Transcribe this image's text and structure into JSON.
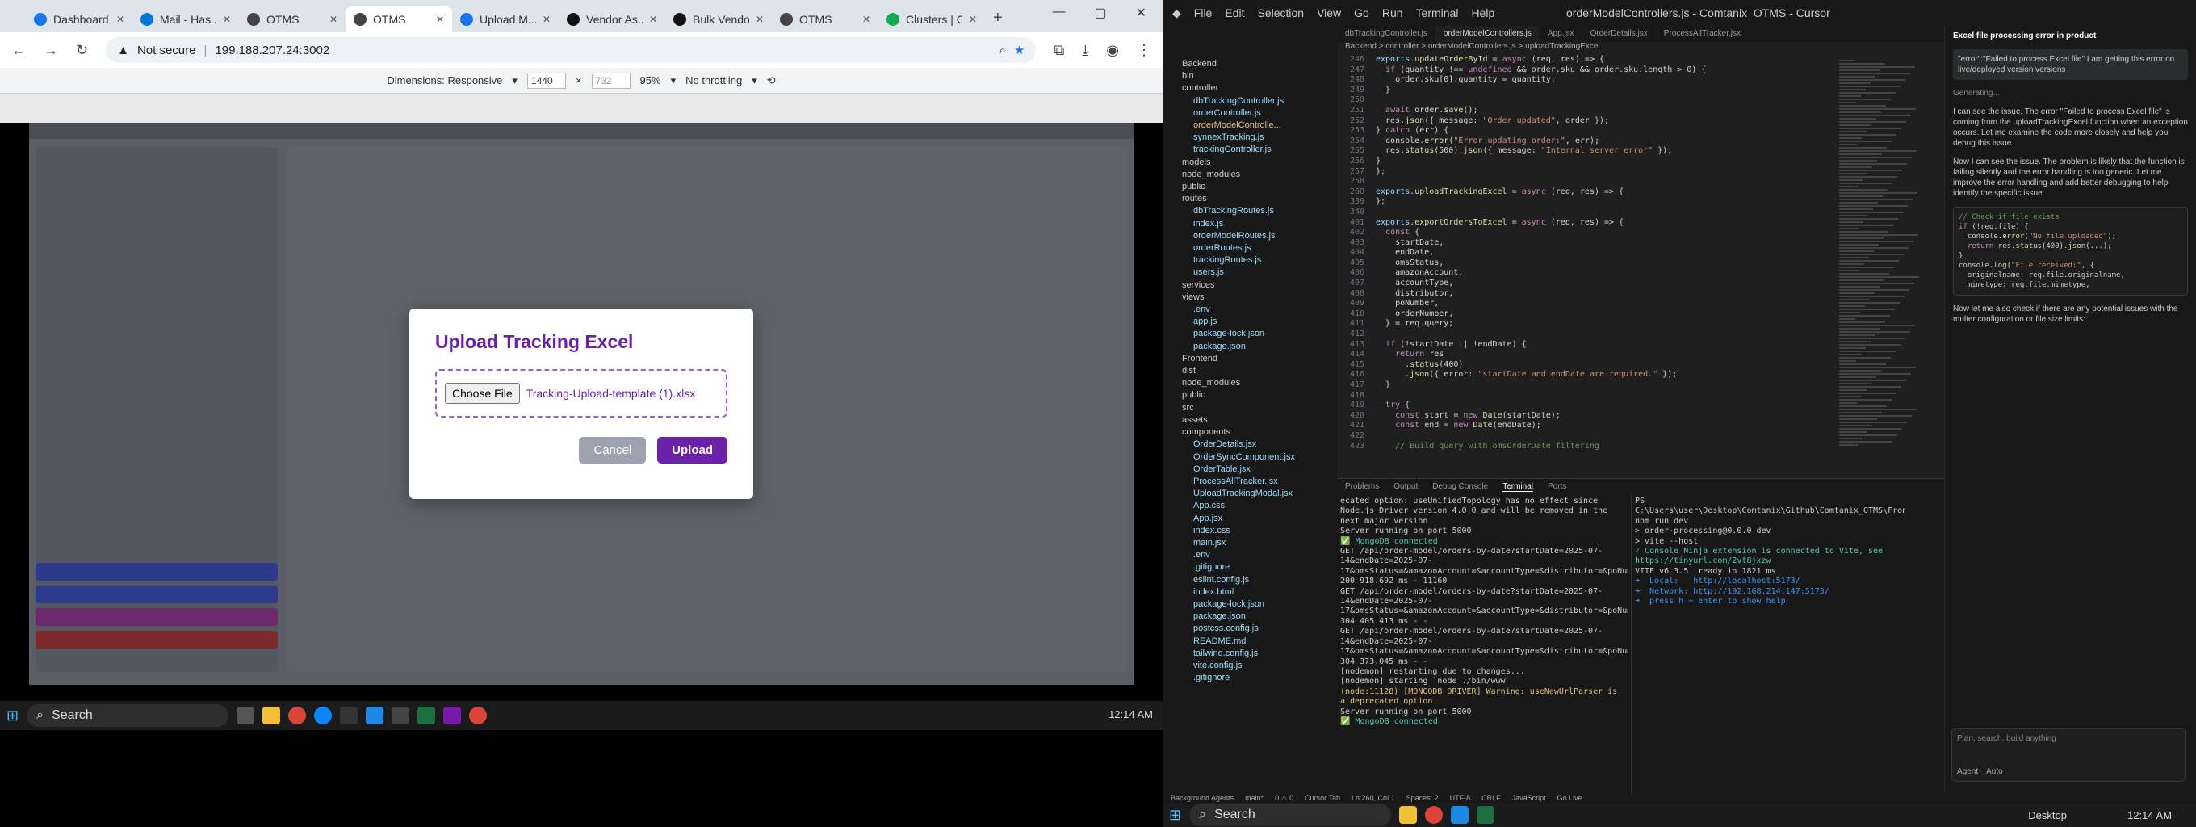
{
  "browser": {
    "tabs": [
      {
        "label": "Dashboard",
        "color": "#1a73e8"
      },
      {
        "label": "Mail - Has...",
        "color": "#0078d4"
      },
      {
        "label": "OTMS",
        "color": "#444"
      },
      {
        "label": "OTMS",
        "color": "#444",
        "active": true
      },
      {
        "label": "Upload M...",
        "color": "#1a73e8"
      },
      {
        "label": "Vendor As...",
        "color": "#111"
      },
      {
        "label": "Bulk Vendo...",
        "color": "#111"
      },
      {
        "label": "OTMS",
        "color": "#444"
      },
      {
        "label": "Clusters | C...",
        "color": "#13aa52"
      }
    ],
    "security": "Not secure",
    "url": "199.188.207.24:3002",
    "devtools": {
      "dimensions_label": "Dimensions: Responsive",
      "width": "1440",
      "height": "732",
      "zoom": "95%",
      "throttle": "No throttling"
    }
  },
  "modal": {
    "title": "Upload Tracking Excel",
    "choose_label": "Choose File",
    "file_name": "Tracking-Upload-template (1).xlsx",
    "cancel_label": "Cancel",
    "upload_label": "Upload"
  },
  "taskbar_left": {
    "search": "Search",
    "time": "12:14 AM"
  },
  "vscode": {
    "title": "orderModelControllers.js - Comtanix_OTMS - Cursor",
    "menu": [
      "File",
      "Edit",
      "Selection",
      "View",
      "Go",
      "Run",
      "Terminal",
      "Help"
    ],
    "tree": [
      "Backend",
      "bin",
      "controller",
      "dbTrackingController.js",
      "orderController.js",
      "orderModelControlle...",
      "synnexTracking.js",
      "trackingController.js",
      "models",
      "node_modules",
      "public",
      "routes",
      "dbTrackingRoutes.js",
      "index.js",
      "orderModelRoutes.js",
      "orderRoutes.js",
      "trackingRoutes.js",
      "users.js",
      "services",
      "views",
      ".env",
      "app.js",
      "package-lock.json",
      "package.json",
      "Frontend",
      "dist",
      "node_modules",
      "public",
      "src",
      "assets",
      "components",
      "OrderDetails.jsx",
      "OrderSyncComponent.jsx",
      "OrderTable.jsx",
      "ProcessAllTracker.jsx",
      "UploadTrackingModal.jsx",
      "App.css",
      "App.jsx",
      "index.css",
      "main.jsx",
      ".env",
      ".gitignore",
      "eslint.config.js",
      "index.html",
      "package-lock.json",
      "package.json",
      "postcss.config.js",
      "README.md",
      "tailwind.config.js",
      "vite.config.js",
      ".gitignore"
    ],
    "editor_tabs": [
      "dbTrackingController.js",
      "orderModelControllers.js",
      "App.jsx",
      "OrderDetails.jsx",
      "ProcessAllTracker.jsx"
    ],
    "breadcrumb": "Backend > controller > orderModelControllers.js > uploadTrackingExcel",
    "panel_tabs": [
      "Problems",
      "Output",
      "Debug Console",
      "Terminal",
      "Ports"
    ],
    "status_items": [
      "Background Agents",
      "main*",
      "0 ⚠ 0",
      "Cursor Tab",
      "Ln 260, Col 1",
      "Spaces: 2",
      "UTF-8",
      "CRLF",
      "JavaScript",
      "Go Live"
    ]
  },
  "terminal_backend": [
    "ecated option: useUnifiedTopology has no effect since Node.js Driver version 4.0.0 and will be removed in the next major version",
    "Server running on port 5000",
    "✅ MongoDB connected",
    "GET /api/order-model/orders-by-date?startDate=2025-07-14&endDate=2025-07-17&omsStatus=&amazonAccount=&accountType=&distributor=&poNumber=&orderNumber=&page=1&limit=20 200 918.692 ms - 11160",
    "GET /api/order-model/orders-by-date?startDate=2025-07-14&endDate=2025-07-17&omsStatus=&amazonAccount=&accountType=&distributor=&poNumber=&orderNumber=&page=1&limit=20 304 405.413 ms - -",
    "GET /api/order-model/orders-by-date?startDate=2025-07-14&endDate=2025-07-17&omsStatus=&amazonAccount=&accountType=&distributor=&poNumber=&orderNumber=&page=1&limit=20 304 373.045 ms - -",
    "[nodemon] restarting due to changes...",
    "[nodemon] starting `node ./bin/www`",
    "(node:11128) [MONGODB DRIVER] Warning: useNewUrlParser is a deprecated option",
    "Server running on port 5000",
    "✅ MongoDB connected"
  ],
  "terminal_frontend": [
    "PS C:\\Users\\user\\Desktop\\Comtanix\\Github\\Comtanix_OTMS\\Frontend> npm run dev",
    "> order-processing@0.0.0 dev",
    "> vite --host",
    "✓ Console Ninja extension is connected to Vite, see https://tinyurl.com/2vt8jxzw",
    "VITE v6.3.5  ready in 1821 ms",
    "➜  Local:   http://localhost:5173/",
    "➜  Network: http://192.168.214.147:5173/",
    "➜  press h + enter to show help"
  ],
  "chat": {
    "header": "Excel file processing error in product",
    "user_msg": "\"error\":\"Failed to process Excel file\" I am getting this error on live/deployed version versions",
    "status": "Generating...",
    "reply1": "I can see the issue. The error \"Failed to process Excel file\" is coming from the uploadTrackingExcel function when an exception occurs. Let me examine the code more closely and help you debug this issue.",
    "reply2": "Now I can see the issue. The problem is likely that the function is failing silently and the error handling is too generic. Let me improve the error handling and add better debugging to help identify the specific issue:",
    "reply3": "Now let me also check if there are any potential issues with the multer configuration or file size limits:",
    "input_placeholder": "Plan, search, build anything",
    "agent_label": "Agent",
    "auto_label": "Auto"
  },
  "taskbar_right": {
    "search": "Search",
    "time": "12:14 AM",
    "desktop": "Desktop"
  }
}
